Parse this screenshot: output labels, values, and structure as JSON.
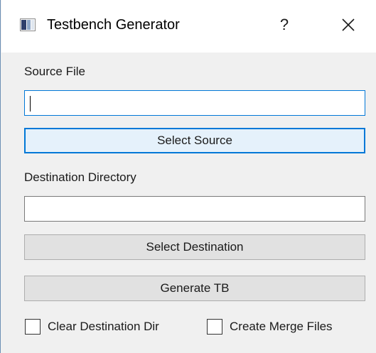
{
  "window": {
    "title": "Testbench Generator",
    "help_glyph": "?",
    "close_icon": "close-icon"
  },
  "form": {
    "source_label": "Source File",
    "source_value": "",
    "select_source_label": "Select Source",
    "destination_label": "Destination Directory",
    "destination_value": "",
    "select_destination_label": "Select Destination",
    "generate_label": "Generate TB",
    "clear_dest_label": "Clear Destination Dir",
    "clear_dest_checked": false,
    "merge_files_label": "Create Merge Files",
    "merge_files_checked": false
  },
  "colors": {
    "focus_accent": "#0078d7",
    "button_face": "#e1e1e1",
    "dialog_background": "#f0f0f0"
  }
}
